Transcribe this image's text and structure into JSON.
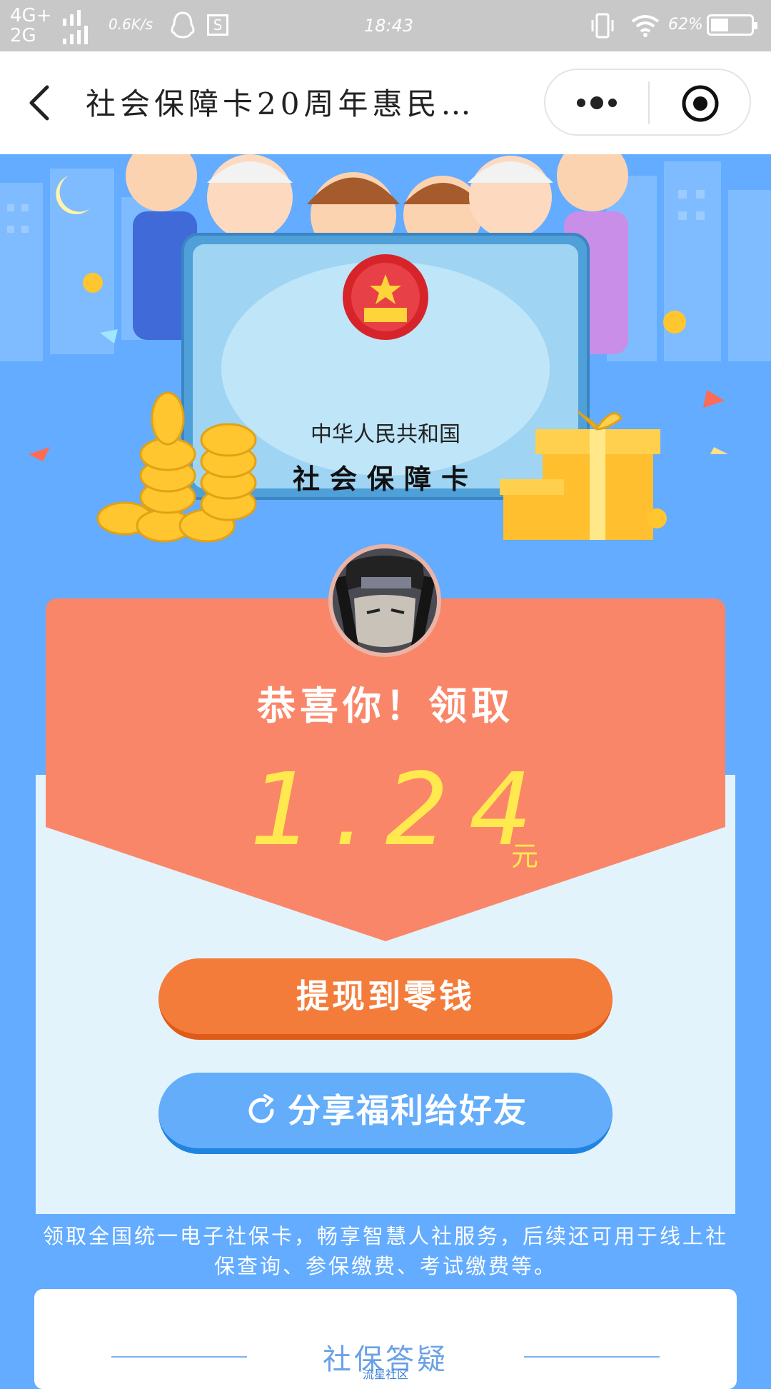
{
  "status_bar": {
    "network_top": "4G+",
    "network_bottom": "2G",
    "speed": "0.6K/s",
    "time": "18:43",
    "battery": "62%",
    "icons": [
      "signal-icon",
      "qq-icon",
      "s-app-icon",
      "vibrate-icon",
      "wifi-icon",
      "battery-icon"
    ]
  },
  "navbar": {
    "title": "社会保障卡20周年惠民…",
    "icons": [
      "back-icon",
      "more-icon",
      "close-miniprogram-icon"
    ]
  },
  "banner": {
    "country_text": "中华人民共和国",
    "card_text": "社会保障卡"
  },
  "packet": {
    "congrats": "恭喜你！领取",
    "amount": "1.24",
    "unit": "元"
  },
  "buttons": {
    "withdraw": "提现到零钱",
    "share": "分享福利给好友"
  },
  "description": "领取全国统一电子社保卡，畅享智慧人社服务，后续还可用于线上社保查询、参保缴费、考试缴费等。",
  "faq": {
    "title": "社保答疑",
    "watermark": "流星社区"
  },
  "colors": {
    "page_bg": "#63acff",
    "packet_red": "#fa8669",
    "amount_yellow": "#ffe94f",
    "withdraw_orange": "#f47c3a",
    "share_blue": "#63adfb"
  }
}
